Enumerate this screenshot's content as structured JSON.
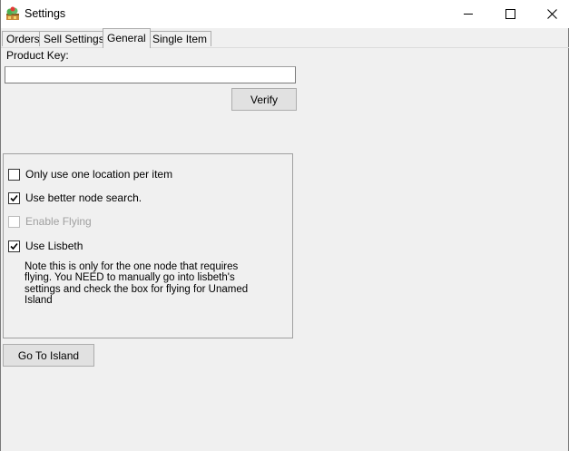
{
  "window": {
    "title": "Settings",
    "icon": "app-icon"
  },
  "tabs": [
    {
      "label": "Orders",
      "active": false
    },
    {
      "label": "Sell Settings",
      "active": false
    },
    {
      "label": "General",
      "active": true
    },
    {
      "label": "Single Item",
      "active": false
    }
  ],
  "general": {
    "product_key_label": "Product Key:",
    "product_key_value": "",
    "verify_label": "Verify",
    "options": [
      {
        "label": "Only use one location per item",
        "checked": false,
        "enabled": true
      },
      {
        "label": "Use better node search.",
        "checked": true,
        "enabled": true
      },
      {
        "label": "Enable Flying",
        "checked": false,
        "enabled": false
      },
      {
        "label": "Use Lisbeth",
        "checked": true,
        "enabled": true
      }
    ],
    "note": "Note this is only for the one node that requires flying. You NEED to manually go into lisbeth's settings and check the box for flying for Unamed Island",
    "go_to_island_label": "Go To Island"
  }
}
